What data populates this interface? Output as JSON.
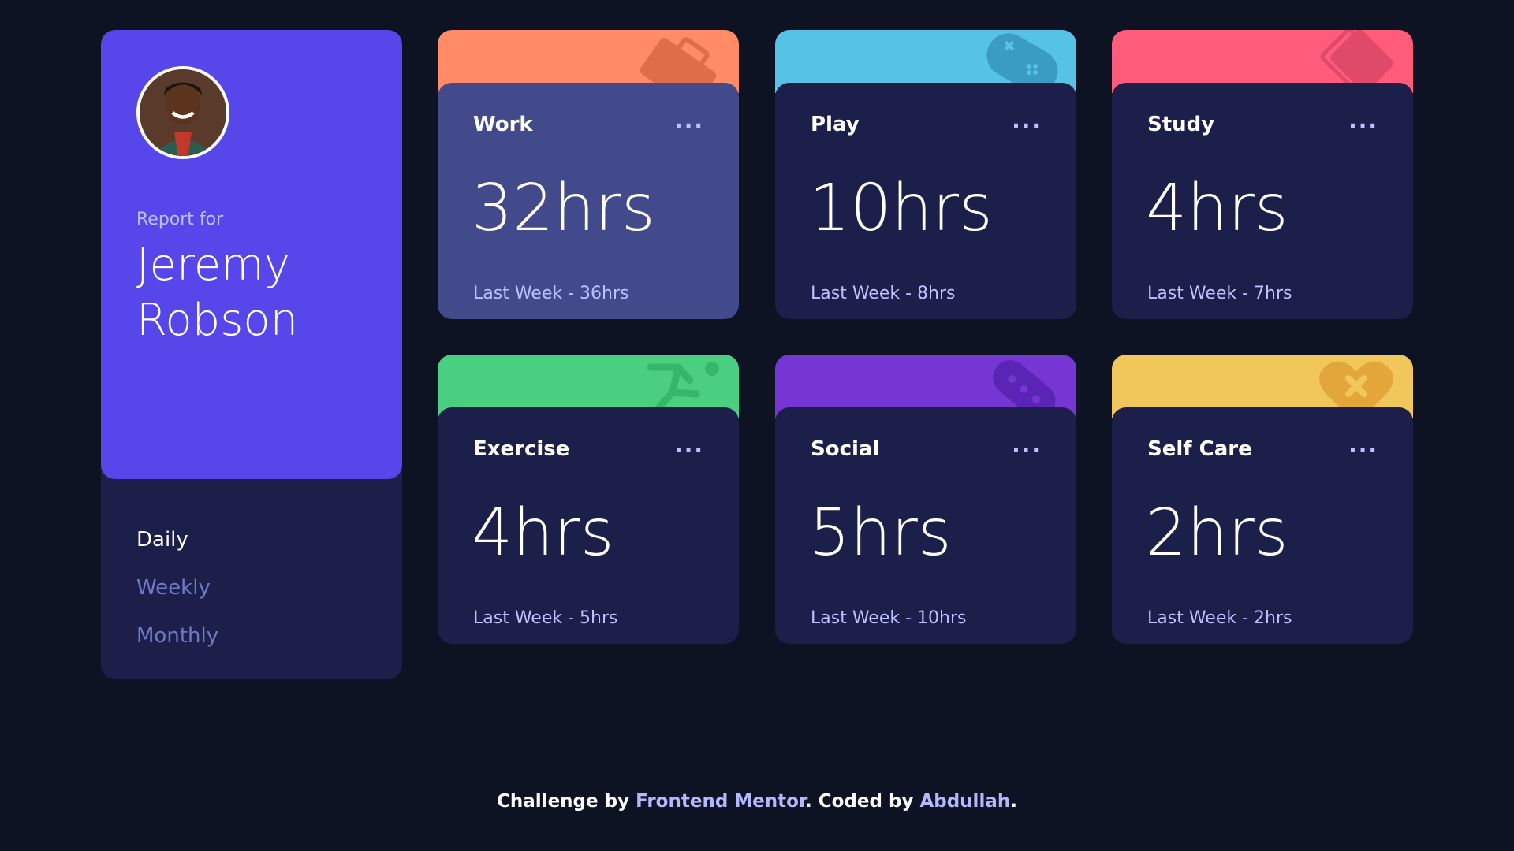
{
  "profile": {
    "report_for": "Report for",
    "name_first": "Jeremy",
    "name_last": "Robson",
    "timeframes": [
      "Daily",
      "Weekly",
      "Monthly"
    ],
    "active_timeframe": "Daily"
  },
  "cards": [
    {
      "title": "Work",
      "hours": "32hrs",
      "last_week": "Last Week - 36hrs",
      "color": "#ff8c66",
      "icon": "briefcase-icon"
    },
    {
      "title": "Play",
      "hours": "10hrs",
      "last_week": "Last Week - 8hrs",
      "color": "#56c2e6",
      "icon": "gamepad-icon"
    },
    {
      "title": "Study",
      "hours": "4hrs",
      "last_week": "Last Week - 7hrs",
      "color": "#ff5c7c",
      "icon": "book-icon"
    },
    {
      "title": "Exercise",
      "hours": "4hrs",
      "last_week": "Last Week - 5hrs",
      "color": "#4acf81",
      "icon": "running-icon"
    },
    {
      "title": "Social",
      "hours": "5hrs",
      "last_week": "Last Week - 10hrs",
      "color": "#7536d3",
      "icon": "chat-icon"
    },
    {
      "title": "Self Care",
      "hours": "2hrs",
      "last_week": "Last Week - 2hrs",
      "color": "#f1c75b",
      "icon": "heart-bandage-icon"
    }
  ],
  "menu_label": "...",
  "footer": {
    "prefix": "Challenge by ",
    "link1": "Frontend Mentor",
    "middle": ". Coded by ",
    "link2": "Abdullah",
    "suffix": "."
  }
}
